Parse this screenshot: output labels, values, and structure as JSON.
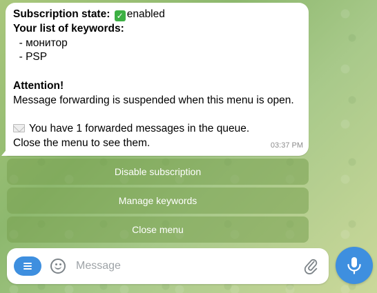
{
  "message": {
    "subscription_label": "Subscription state:",
    "subscription_value": "enabled",
    "keywords_label": "Your list of keywords:",
    "keywords": [
      "  - монитор",
      "  - PSP"
    ],
    "attention_label": "Attention!",
    "attention_text": "Message forwarding is suspended when this menu is open.",
    "queue_text": "You have 1 forwarded messages in the queue.",
    "close_hint": "Close the menu to see them.",
    "time": "03:37 PM"
  },
  "keyboard": {
    "buttons": [
      {
        "label": "Disable subscription"
      },
      {
        "label": "Manage keywords"
      },
      {
        "label": "Close menu"
      }
    ]
  },
  "composer": {
    "placeholder": "Message"
  },
  "icons": {
    "menu": "menu-icon",
    "emoji": "smile-icon",
    "attach": "paperclip-icon",
    "mic": "microphone-icon",
    "check": "check-mark-icon",
    "envelope": "envelope-icon"
  },
  "colors": {
    "accent": "#3e8fdf",
    "check": "#3cb043",
    "keyboard_button": "#7aa050"
  }
}
